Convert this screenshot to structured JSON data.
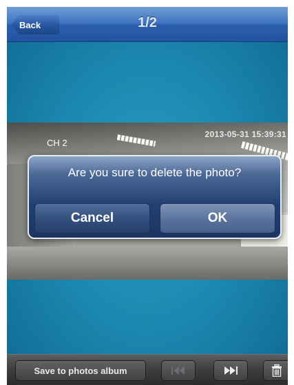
{
  "navbar": {
    "back_label": "Back",
    "title": "1/2"
  },
  "photo": {
    "channel_label": "CH 2",
    "timestamp": "2013-05-31 15:39:31"
  },
  "dialog": {
    "message": "Are you sure to delete the photo?",
    "cancel_label": "Cancel",
    "ok_label": "OK"
  },
  "toolbar": {
    "save_label": "Save to photos album",
    "prev_icon": "skip-previous-icon",
    "next_icon": "skip-next-icon",
    "delete_icon": "trash-icon"
  }
}
